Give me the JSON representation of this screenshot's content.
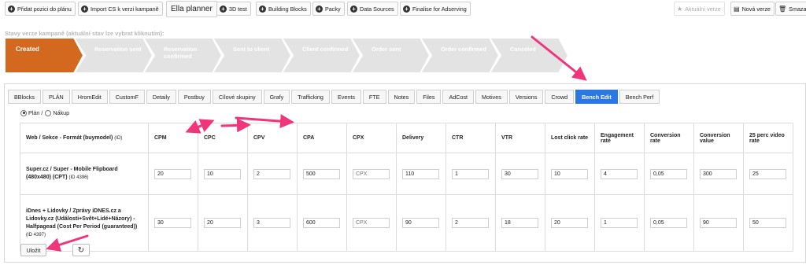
{
  "toolbar": {
    "add_position": "Přidat pozici do plánu",
    "import_cs": "Import CS k verzi kampaně",
    "ella_planner": "Ella planner",
    "test_3d": "3D test",
    "building_blocks": "Building Blocks",
    "packy": "Packy",
    "data_sources": "Data Sources",
    "finalise": "Finalise for Adserving",
    "current_version": "Aktuální verze",
    "new_version": "Nová verze",
    "delete": "Smazat"
  },
  "status": {
    "title": "Stavy verze kampaně (aktuální stav lze vybrat kliknutím):",
    "steps": [
      {
        "label": "Created",
        "active": true
      },
      {
        "label": "Reservation sent",
        "active": false
      },
      {
        "label": "Reservation confirmed",
        "active": false
      },
      {
        "label": "Sent to client",
        "active": false
      },
      {
        "label": "Client confirmed",
        "active": false
      },
      {
        "label": "Order sent",
        "active": false
      },
      {
        "label": "Order confirmed",
        "active": false
      },
      {
        "label": "Canceled",
        "active": false
      }
    ],
    "active_color": "#d2691e",
    "inactive_color": "#e3e3e3"
  },
  "tabs": [
    "BBlocks",
    "PLÁN",
    "HromEdit",
    "CustomF",
    "Detaily",
    "Postbuy",
    "Cílové skupiny",
    "Grafy",
    "Trafficking",
    "Events",
    "FTE",
    "Notes",
    "Files",
    "AdCost",
    "Motives",
    "Versions",
    "Crowd",
    "Bench Edit",
    "Bench Perf"
  ],
  "active_tab": "Bench Edit",
  "mode": {
    "plan": "Plán /",
    "nakup": "Nákup"
  },
  "table": {
    "first_header": "Web / Sekce - Formát (buymodel)",
    "first_header_id": "(ID)",
    "columns": [
      "CPM",
      "CPC",
      "CPV",
      "CPA",
      "CPX",
      "Delivery",
      "CTR",
      "VTR",
      "Lost click rate",
      "Engagement rate",
      "Conversion rate",
      "Conversion value",
      "25 perc video rate"
    ],
    "rows": [
      {
        "label": "Super.cz / Super - Mobile Flipboard (480x480) (CPT)",
        "id": "(ID 4396)",
        "values": [
          "20",
          "10",
          "2",
          "500",
          "",
          "110",
          "1",
          "30",
          "10",
          "4",
          "0,05",
          "300",
          "25"
        ]
      },
      {
        "label": "iDnes + Lidovky / Zprávy iDNES.cz a Lidovky.cz (Události+Svět+Lidé+Názory) - Halfpagead (Cost Per Period (guaranteed))",
        "id": "(ID 4397)",
        "values": [
          "30",
          "20",
          "3",
          "600",
          "",
          "90",
          "2",
          "18",
          "20",
          "1",
          "0,05",
          "90",
          "50"
        ]
      }
    ],
    "cpx_placeholder": "CPX"
  },
  "save_label": "Uložit",
  "refresh_icon": "refresh-icon",
  "annotation_color": "#f0357a"
}
